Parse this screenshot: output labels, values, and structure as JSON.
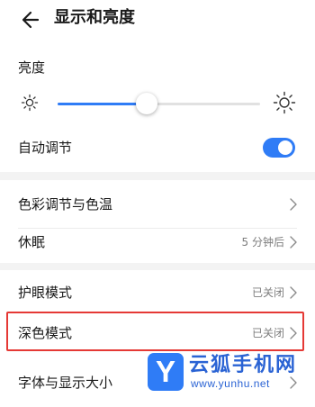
{
  "header": {
    "title": "显示和亮度"
  },
  "brightness": {
    "label": "亮度",
    "level": 0.44
  },
  "auto_adjust": {
    "label": "自动调节",
    "enabled": true
  },
  "rows": [
    {
      "label": "色彩调节与色温",
      "value": ""
    },
    {
      "label": "休眠",
      "value": "5 分钟后"
    },
    {
      "label": "护眼模式",
      "value": "已关闭"
    },
    {
      "label": "深色模式",
      "value": "已关闭"
    },
    {
      "label": "字体与显示大小",
      "value": ""
    }
  ],
  "watermark": {
    "badge": "Y",
    "title": "云狐手机网",
    "url": "www.yunhu.net"
  },
  "colors": {
    "accent": "#2f7cf6",
    "highlight": "#e53935",
    "band": "#f3f3f3"
  }
}
